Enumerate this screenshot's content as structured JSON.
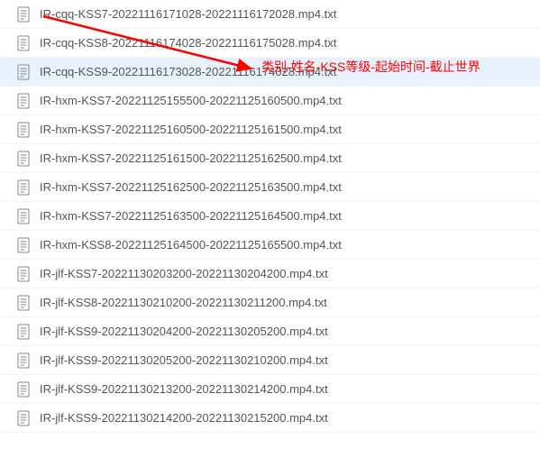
{
  "files": [
    {
      "name": "IR-cqq-KSS7-20221116171028-20221116172028.mp4.txt",
      "selected": false
    },
    {
      "name": "IR-cqq-KSS8-20221116174028-20221116175028.mp4.txt",
      "selected": false
    },
    {
      "name": "IR-cqq-KSS9-20221116173028-20221116174028.mp4.txt",
      "selected": true
    },
    {
      "name": "IR-hxm-KSS7-20221125155500-20221125160500.mp4.txt",
      "selected": false
    },
    {
      "name": "IR-hxm-KSS7-20221125160500-20221125161500.mp4.txt",
      "selected": false
    },
    {
      "name": "IR-hxm-KSS7-20221125161500-20221125162500.mp4.txt",
      "selected": false
    },
    {
      "name": "IR-hxm-KSS7-20221125162500-20221125163500.mp4.txt",
      "selected": false
    },
    {
      "name": "IR-hxm-KSS7-20221125163500-20221125164500.mp4.txt",
      "selected": false
    },
    {
      "name": "IR-hxm-KSS8-20221125164500-20221125165500.mp4.txt",
      "selected": false
    },
    {
      "name": "IR-jlf-KSS7-20221130203200-20221130204200.mp4.txt",
      "selected": false
    },
    {
      "name": "IR-jlf-KSS8-20221130210200-20221130211200.mp4.txt",
      "selected": false
    },
    {
      "name": "IR-jlf-KSS9-20221130204200-20221130205200.mp4.txt",
      "selected": false
    },
    {
      "name": "IR-jlf-KSS9-20221130205200-20221130210200.mp4.txt",
      "selected": false
    },
    {
      "name": "IR-jlf-KSS9-20221130213200-20221130214200.mp4.txt",
      "selected": false
    },
    {
      "name": "IR-jlf-KSS9-20221130214200-20221130215200.mp4.txt",
      "selected": false
    }
  ],
  "annotation_text": "类别-姓名-KSS等级-起始时间-截止世界",
  "icon_color": "#888888"
}
